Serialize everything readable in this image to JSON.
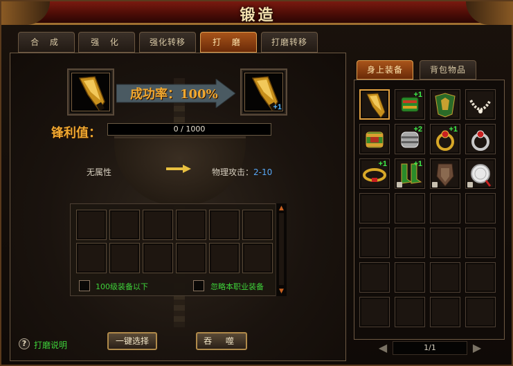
{
  "window": {
    "title": "锻造"
  },
  "tabs": [
    {
      "label": "合 成",
      "active": false
    },
    {
      "label": "强 化",
      "active": false
    },
    {
      "label": "强化转移",
      "active": false
    },
    {
      "label": "打 磨",
      "active": true
    },
    {
      "label": "打磨转移",
      "active": false
    }
  ],
  "forge": {
    "source_item_icon": "golden-sword-icon",
    "result_item_icon": "golden-sword-icon",
    "result_plus": "+1",
    "success_rate": "成功率：100%",
    "sharpness_label": "锋利值：",
    "sharpness_text": "0 / 1000",
    "sharpness_fraction": 0,
    "attr_before": "无属性",
    "attr_after_label": "物理攻击：",
    "attr_after_value": "2-10"
  },
  "material_grid": {
    "rows": 2,
    "cols": 6,
    "filter_level": "100级装备以下",
    "filter_class": "忽略本职业装备"
  },
  "help_link": "打磨说明",
  "buttons": {
    "auto_select": "一键选择",
    "devour": "吞 噬"
  },
  "equipment_tabs": [
    {
      "label": "身上装备",
      "active": true
    },
    {
      "label": "背包物品",
      "active": false
    }
  ],
  "equipment": [
    {
      "icon": "golden-sword-icon",
      "plus": "",
      "locked": false,
      "selected": true
    },
    {
      "icon": "green-bracer-icon",
      "plus": "+1",
      "locked": false,
      "selected": false
    },
    {
      "icon": "green-armor-icon",
      "plus": "",
      "locked": false,
      "selected": false
    },
    {
      "icon": "tooth-necklace-icon",
      "plus": "",
      "locked": false,
      "selected": false
    },
    {
      "icon": "gold-bracer-icon",
      "plus": "",
      "locked": false,
      "selected": false
    },
    {
      "icon": "silver-bracer-icon",
      "plus": "+2",
      "locked": false,
      "selected": false
    },
    {
      "icon": "red-ring-icon",
      "plus": "+1",
      "locked": false,
      "selected": false
    },
    {
      "icon": "silver-ring-icon",
      "plus": "",
      "locked": false,
      "selected": false
    },
    {
      "icon": "gold-belt-icon",
      "plus": "+1",
      "locked": false,
      "selected": false
    },
    {
      "icon": "green-boots-icon",
      "plus": "+1",
      "locked": true,
      "selected": false
    },
    {
      "icon": "shield-icon",
      "plus": "",
      "locked": true,
      "selected": false
    },
    {
      "icon": "silver-medal-icon",
      "plus": "",
      "locked": true,
      "selected": false
    }
  ],
  "equipment_grid": {
    "rows": 7,
    "cols": 4
  },
  "pager": {
    "text": "1/1"
  },
  "colors": {
    "accent_gold": "#f0a830",
    "green_text": "#3ed23a",
    "blue_value": "#58a8f8",
    "plus_green": "#3ef04a"
  }
}
